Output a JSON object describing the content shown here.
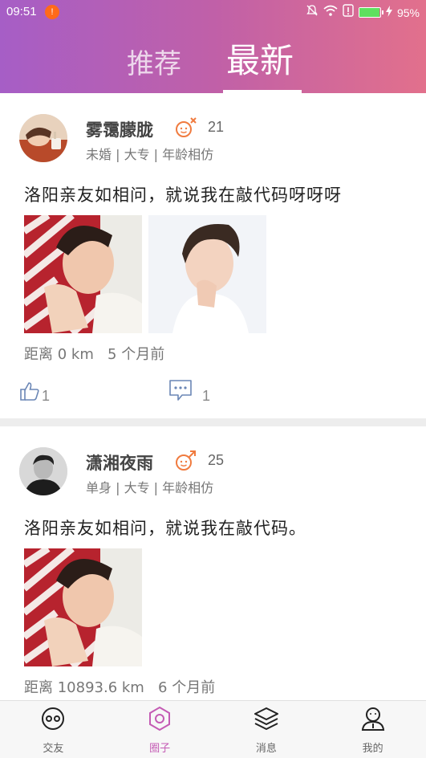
{
  "status_bar": {
    "time": "09:51",
    "warning_icon": "warning-icon",
    "icons": [
      "bell-muted-icon",
      "wifi-icon",
      "alert-icon",
      "battery-icon",
      "charging-icon"
    ],
    "battery_percent": "95%",
    "battery_level": 0.95
  },
  "tabs": [
    {
      "label": "推荐",
      "active": false
    },
    {
      "label": "最新",
      "active": true
    }
  ],
  "posts": [
    {
      "username": "雾霭朦胧",
      "gender": "male",
      "age": "21",
      "meta": "未婚 | 大专 | 年龄相仿",
      "text": "洛阳亲友如相问，就说我在敲代码呀呀呀",
      "photos": [
        "photo-man-reclining",
        "photo-man-hand-chin"
      ],
      "distance": "距离 0 km",
      "time_ago": "5 个月前",
      "likes": "1",
      "comments": "1"
    },
    {
      "username": "潇湘夜雨",
      "gender": "male",
      "age": "25",
      "meta": "单身 | 大专 | 年龄相仿",
      "text": "洛阳亲友如相问，就说我在敲代码。",
      "photos": [
        "photo-man-reclining"
      ],
      "distance": "距离 10893.6 km",
      "time_ago": "6 个月前"
    }
  ],
  "bottom_nav": [
    {
      "label": "交友",
      "icon": "friends-icon",
      "active": false
    },
    {
      "label": "圈子",
      "icon": "circle-hexagon-icon",
      "active": true
    },
    {
      "label": "消息",
      "icon": "layers-icon",
      "active": false
    },
    {
      "label": "我的",
      "icon": "profile-icon",
      "active": false
    }
  ],
  "colors": {
    "header_gradient_start": "#a65ec6",
    "header_gradient_end": "#e2708c",
    "accent": "#c45bb4",
    "male_symbol": "#f07b3f"
  }
}
